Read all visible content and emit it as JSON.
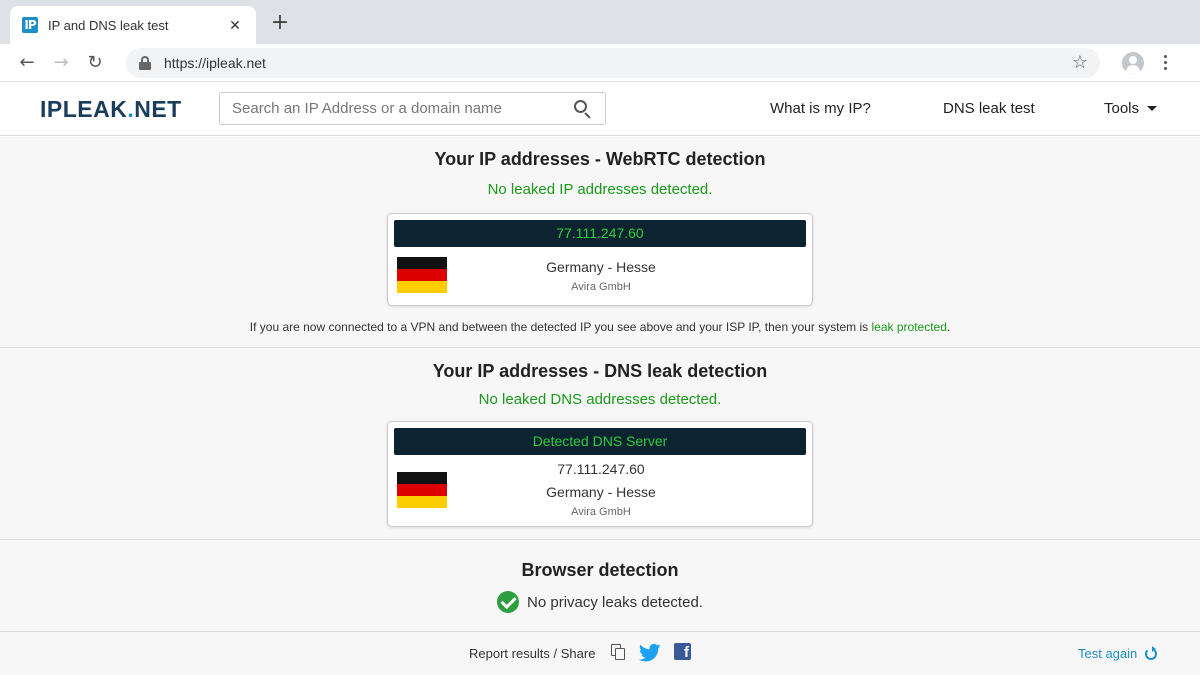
{
  "browser": {
    "tab_title": "IP and DNS leak test",
    "tab_favicon": "IP",
    "url": "https://ipleak.net"
  },
  "site": {
    "logo_main": "IPLEAK",
    "logo_dot": ".",
    "logo_suffix": "NET",
    "search_placeholder": "Search an IP Address or a domain name",
    "nav": {
      "what_is_my_ip": "What is my IP?",
      "dns_leak_test": "DNS leak test",
      "tools": "Tools"
    }
  },
  "webrtc": {
    "title": "Your IP addresses - WebRTC detection",
    "status": "No leaked IP addresses detected.",
    "card": {
      "header": "77.111.247.60",
      "location": "Germany - Hesse",
      "isp": "Avira GmbH"
    },
    "note_prefix": "If you are now connected to a VPN and between the detected IP you see above and your ISP IP, then your system is ",
    "note_link": "leak protected",
    "note_suffix": "."
  },
  "dns": {
    "title": "Your IP addresses - DNS leak detection",
    "status": "No leaked DNS addresses detected.",
    "card": {
      "header": "Detected DNS Server",
      "ip": "77.111.247.60",
      "location": "Germany - Hesse",
      "isp": "Avira GmbH"
    }
  },
  "browser_detection": {
    "title": "Browser detection",
    "status": "No privacy leaks detected."
  },
  "footer": {
    "share_label": "Report results / Share",
    "test_again": "Test again"
  },
  "colors": {
    "status_green": "#1a9a1a",
    "card_header_bg": "#0c2430",
    "card_header_text": "#2ecc40",
    "logo_dark": "#1a3d5c",
    "accent_blue": "#1e8fc6",
    "facebook_blue": "#3b5998",
    "twitter_blue": "#1da1f2"
  },
  "icons": [
    "copy-icon",
    "twitter-icon",
    "facebook-icon",
    "refresh-icon",
    "search-icon",
    "lock-icon",
    "star-icon",
    "profile-icon",
    "menu-icon",
    "check-icon",
    "germany-flag-icon"
  ]
}
